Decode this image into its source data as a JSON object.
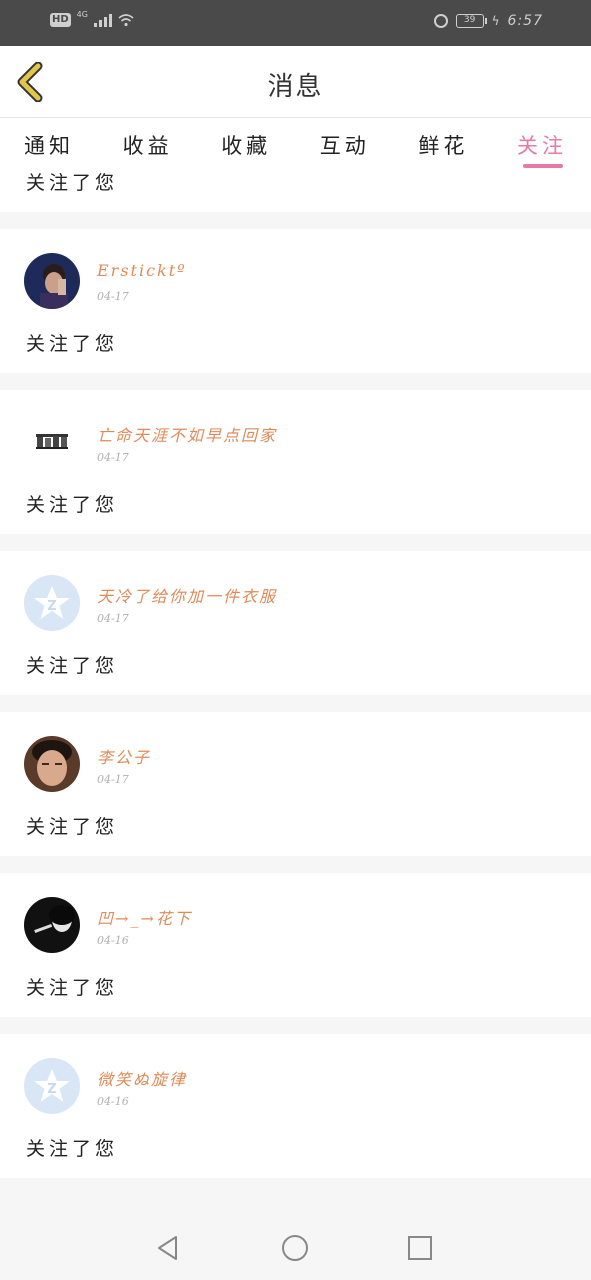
{
  "status_bar": {
    "hd_label": "HD",
    "network_label": "4G",
    "battery": "39",
    "time": "6:57"
  },
  "header": {
    "title": "消息",
    "back_icon": "chevron-left-icon"
  },
  "tabs": [
    {
      "label": "通知",
      "active": false
    },
    {
      "label": "收益",
      "active": false
    },
    {
      "label": "收藏",
      "active": false
    },
    {
      "label": "互动",
      "active": false
    },
    {
      "label": "鲜花",
      "active": false
    },
    {
      "label": "关注",
      "active": true
    }
  ],
  "notifications": [
    {
      "username": "",
      "date": "",
      "action": "关注了您"
    },
    {
      "username": "Ersticktº",
      "date": "04-17",
      "action": "关注了您"
    },
    {
      "username": "亡命天涯不如早点回家",
      "date": "04-17",
      "action": "关注了您"
    },
    {
      "username": "天冷了给你加一件衣服",
      "date": "04-17",
      "action": "关注了您"
    },
    {
      "username": "李公子",
      "date": "04-17",
      "action": "关注了您"
    },
    {
      "username": "凹→_→花下",
      "date": "04-16",
      "action": "关注了您"
    },
    {
      "username": "微笑ぬ旋律",
      "date": "04-16",
      "action": "关注了您"
    }
  ],
  "colors": {
    "accent": "#e77aa8",
    "username": "#e08a58",
    "back_arrow": "#e0c64a"
  }
}
